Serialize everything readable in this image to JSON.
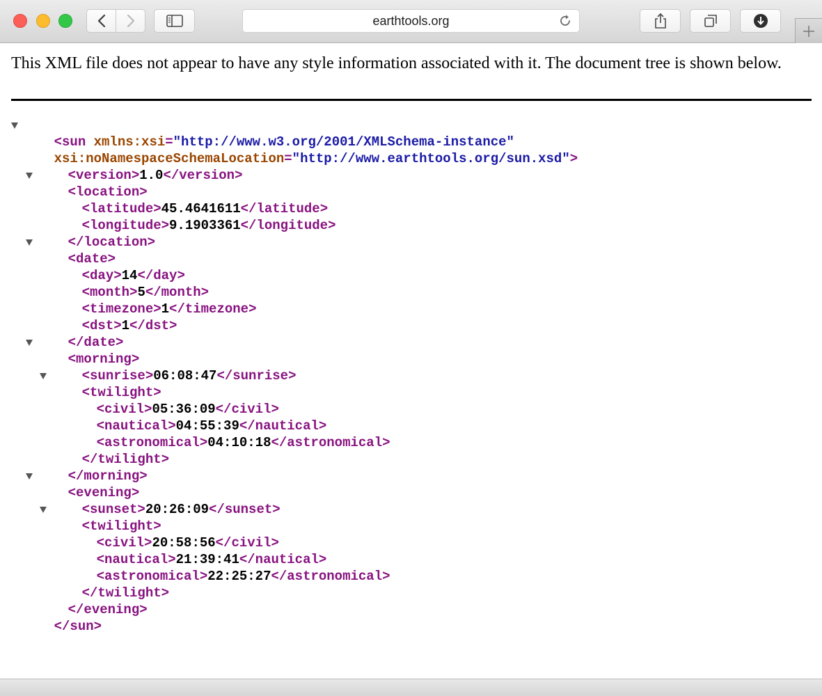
{
  "toolbar": {
    "address": "earthtools.org",
    "icons": {
      "back": "chevron-left-icon",
      "forward": "chevron-right-icon",
      "sidebar": "sidebar-icon",
      "reload": "reload-icon",
      "share": "share-icon",
      "tabs": "tabs-overview-icon",
      "downloads": "download-icon",
      "new_tab": "plus-icon"
    }
  },
  "document": {
    "info": "This XML file does not appear to have any style information associated with it. The document tree is shown below."
  },
  "xml": {
    "root_open_1": "<sun ",
    "xsi_attr": "xmlns:xsi",
    "eq": "=",
    "xsi_value": "\"http://www.w3.org/2001/XMLSchema-instance\"",
    "loc_attr": "xsi:noNamespaceSchemaLocation",
    "loc_value": "\"http://www.earthtools.org/sun.xsd\"",
    "gt": ">",
    "version_open": "<version>",
    "version": "1.0",
    "version_close": "</version>",
    "location_open": "<location>",
    "latitude_open": "<latitude>",
    "latitude": "45.4641611",
    "latitude_close": "</latitude>",
    "longitude_open": "<longitude>",
    "longitude": "9.1903361",
    "longitude_close": "</longitude>",
    "location_close": "</location>",
    "date_open": "<date>",
    "day_open": "<day>",
    "day": "14",
    "day_close": "</day>",
    "month_open": "<month>",
    "month": "5",
    "month_close": "</month>",
    "timezone_open": "<timezone>",
    "timezone": "1",
    "timezone_close": "</timezone>",
    "dst_open": "<dst>",
    "dst": "1",
    "dst_close": "</dst>",
    "date_close": "</date>",
    "morning_open": "<morning>",
    "sunrise_open": "<sunrise>",
    "sunrise": "06:08:47",
    "sunrise_close": "</sunrise>",
    "twilight_open": "<twilight>",
    "civil_open": "<civil>",
    "civil_close": "</civil>",
    "nautical_open": "<nautical>",
    "nautical_close": "</nautical>",
    "astronomical_open": "<astronomical>",
    "astronomical_close": "</astronomical>",
    "morning_civil": "05:36:09",
    "morning_nautical": "04:55:39",
    "morning_astronomical": "04:10:18",
    "twilight_close": "</twilight>",
    "morning_close": "</morning>",
    "evening_open": "<evening>",
    "sunset_open": "<sunset>",
    "sunset": "20:26:09",
    "sunset_close": "</sunset>",
    "evening_civil": "20:58:56",
    "evening_nautical": "21:39:41",
    "evening_astronomical": "22:25:27",
    "evening_close": "</evening>",
    "root_close": "</sun>"
  }
}
